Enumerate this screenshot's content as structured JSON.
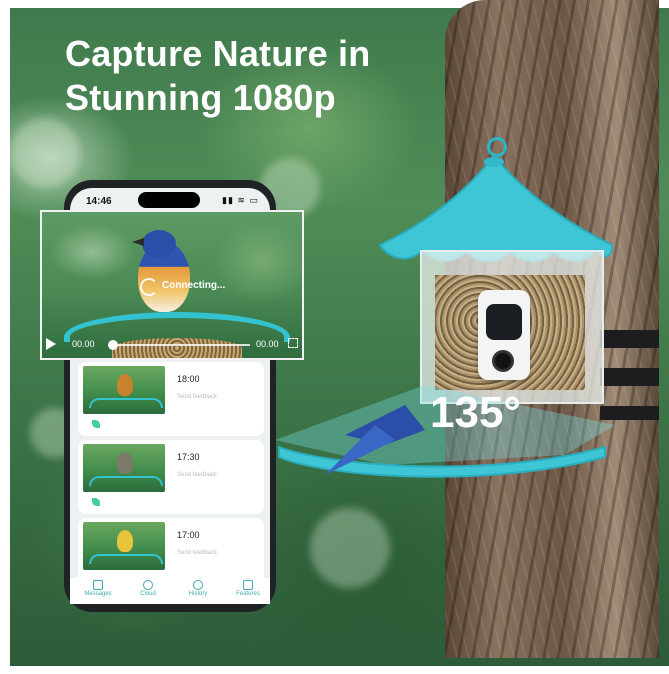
{
  "headline": {
    "line1": "Capture Nature in",
    "line2": "Stunning 1080p"
  },
  "view_angle_label": "135°",
  "phone": {
    "status_time": "14:46",
    "status_icons": "signal-wifi-battery-icons",
    "video_player": {
      "status_text": "Connecting...",
      "time_start": "00.00",
      "time_end": "00.00",
      "progress": 0.0
    },
    "cards": [
      {
        "time": "18:00",
        "subtitle": "Send feedback"
      },
      {
        "time": "17:30",
        "subtitle": "Send feedback"
      },
      {
        "time": "17:00",
        "subtitle": "Send feedback"
      }
    ],
    "tabs": [
      {
        "label": "Messages",
        "icon": "mail-icon"
      },
      {
        "label": "Cloud",
        "icon": "cloud-icon"
      },
      {
        "label": "History",
        "icon": "clock-icon"
      },
      {
        "label": "Features",
        "icon": "user-gear-icon"
      }
    ]
  },
  "colors": {
    "accent_teal": "#33c2cf",
    "roof_blue": "#3fc6d6",
    "tab_text": "#3fa8b6"
  }
}
